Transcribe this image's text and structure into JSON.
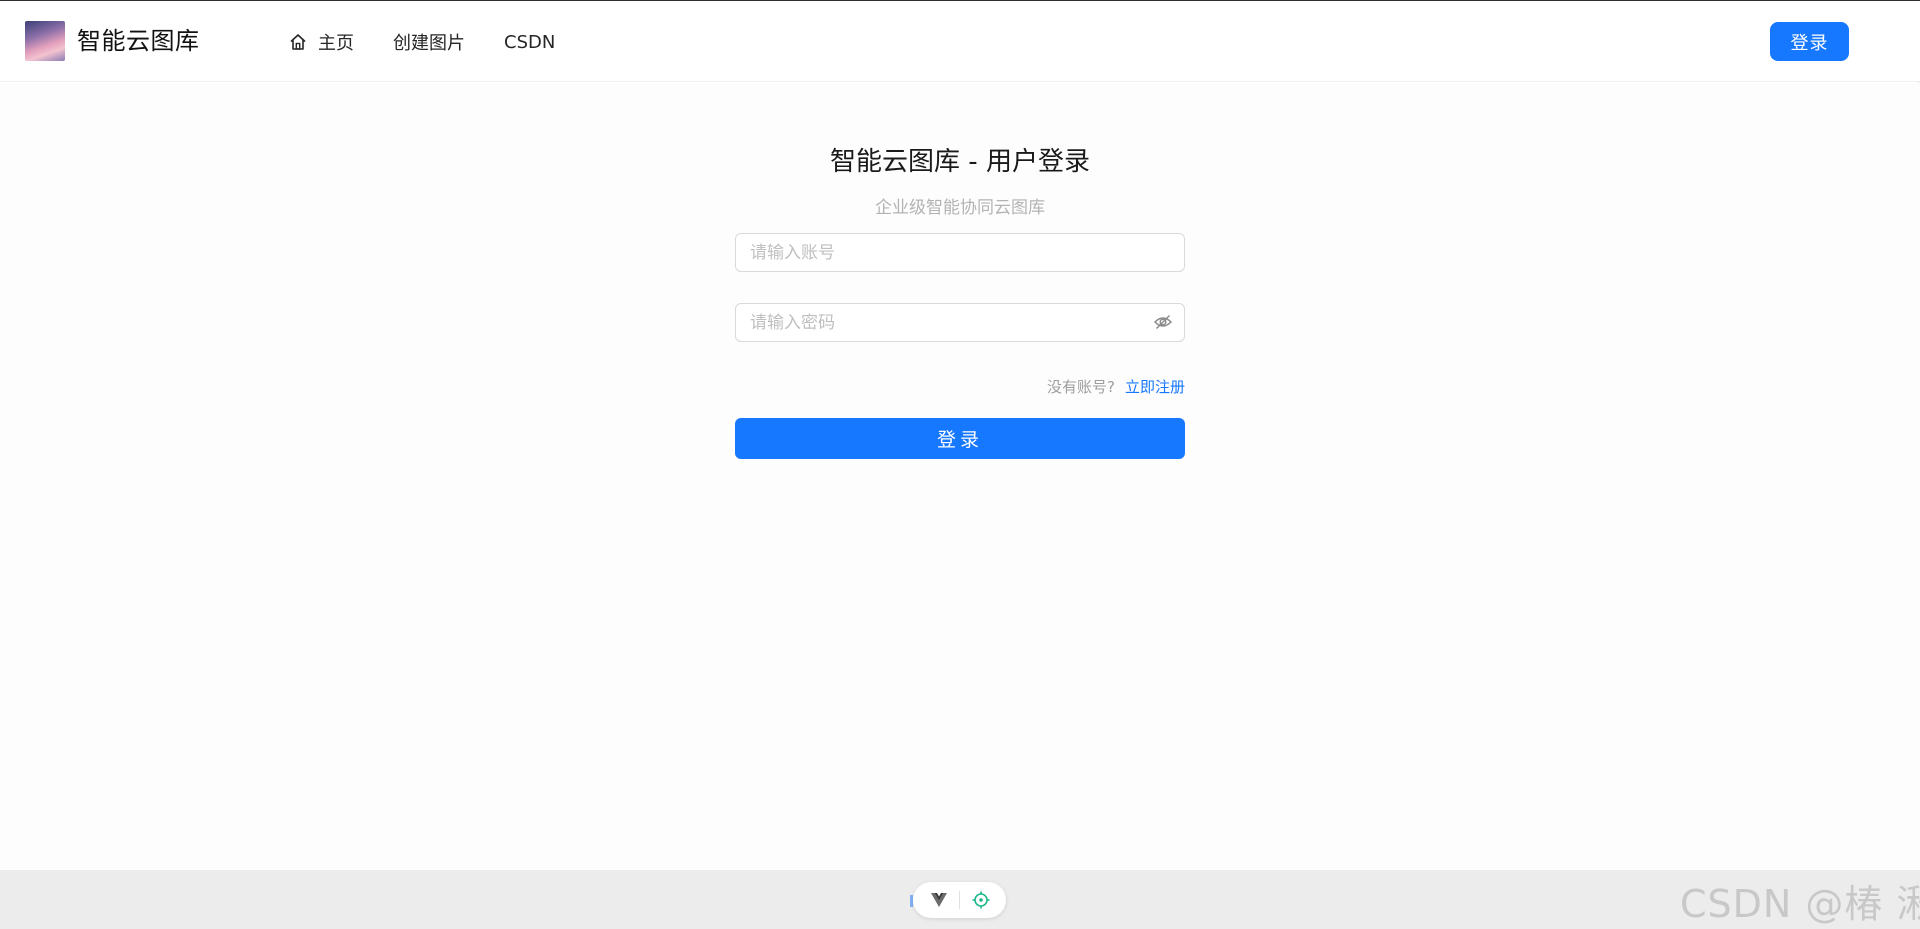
{
  "header": {
    "app_title": "智能云图库",
    "nav": [
      {
        "label": "主页",
        "icon": "home-icon"
      },
      {
        "label": "创建图片"
      },
      {
        "label": "CSDN"
      }
    ],
    "login_button": "登录"
  },
  "login_form": {
    "title": "智能云图库 - 用户登录",
    "subtitle": "企业级智能协同云图库",
    "account_placeholder": "请输入账号",
    "password_placeholder": "请输入密码",
    "password_toggle_icon": "eye-invisible-icon",
    "register_hint": "没有账号?",
    "register_link": "立即注册",
    "submit_label": "登录"
  },
  "footer": {
    "devtools_icons": [
      "vue-icon",
      "target-icon"
    ],
    "watermark": "CSDN @椿  湫"
  },
  "colors": {
    "primary": "#1677ff",
    "placeholder": "#bfbfbf",
    "muted_text": "#b3b3b3",
    "footer_bg": "#ececec"
  }
}
